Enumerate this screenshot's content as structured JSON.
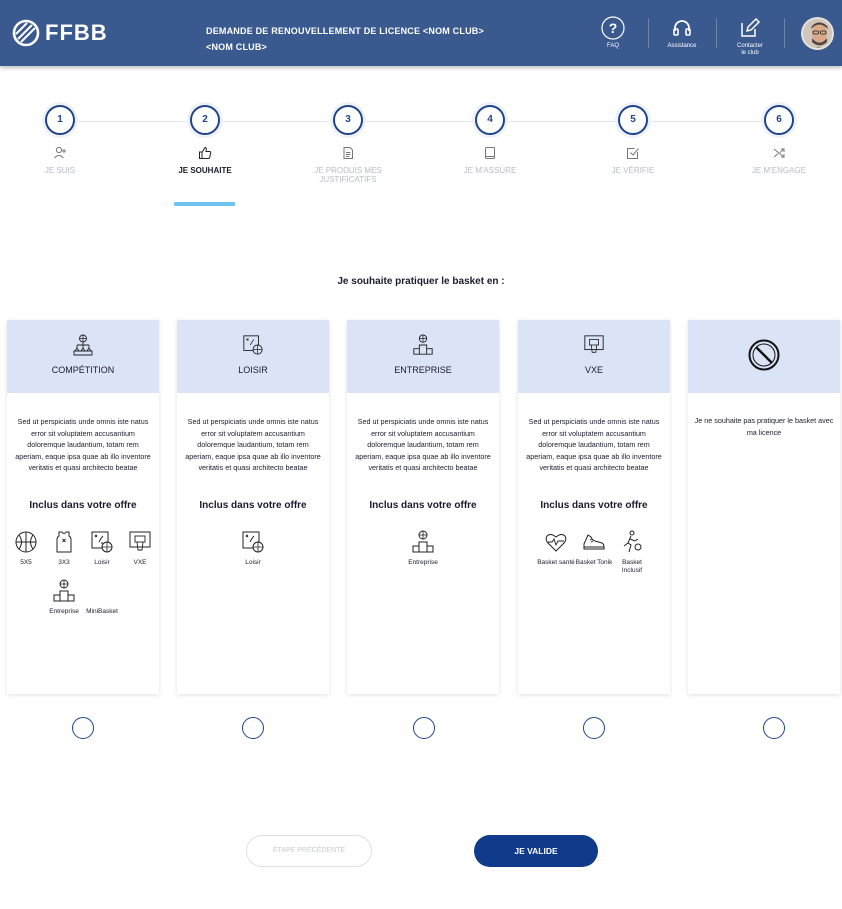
{
  "header": {
    "logo_text": "FFBB",
    "title_line1": "DEMANDE DE RENOUVELLEMENT DE LICENCE <NOM CLUB>",
    "title_line2": "<NOM CLUB>",
    "faq_label": "FAQ",
    "assistance_label": "Assistance",
    "contact_line1": "Contacter",
    "contact_line2": "le club"
  },
  "steps": [
    {
      "number": "1",
      "label": "JE SUIS",
      "icon": "user-add-icon"
    },
    {
      "number": "2",
      "label": "JE SOUHAITE",
      "icon": "thumbs-up-icon"
    },
    {
      "number": "3",
      "label": "JE PRODUIS MES JUSTIFICATIFS",
      "icon": "document-icon"
    },
    {
      "number": "4",
      "label": "JE M'ASSURE",
      "icon": "book-icon"
    },
    {
      "number": "5",
      "label": "JE VÉRIFIE",
      "icon": "check-square-icon"
    },
    {
      "number": "6",
      "label": "JE M'ENGAGE",
      "icon": "shuffle-icon"
    }
  ],
  "question": "Je souhaite pratiquer le basket en :",
  "cards": [
    {
      "title": "COMPÉTITION",
      "description": "Sed ut perspiciatis unde omnis iste natus error sit voluptatem accusantium doloremque laudantium, totam rem aperiam, eaque ipsa quae ab illo inventore veritatis et quasi architecto beatae",
      "included_title": "Inclus dans votre offre",
      "included": [
        "5X5",
        "3X3",
        "Loisir",
        "VXE",
        "Entreprise",
        "MiniBasket"
      ]
    },
    {
      "title": "LOISIR",
      "description": "Sed ut perspiciatis unde omnis iste natus error sit voluptatem accusantium doloremque laudantium, totam rem aperiam, eaque ipsa quae ab illo inventore veritatis et quasi architecto beatae",
      "included_title": "Inclus dans votre offre",
      "included": [
        "Loisir"
      ]
    },
    {
      "title": "ENTREPRISE",
      "description": "Sed ut perspiciatis unde omnis iste natus error sit voluptatem accusantium doloremque laudantium, totam rem aperiam, eaque ipsa quae ab illo inventore veritatis et quasi architecto beatae",
      "included_title": "Inclus dans votre offre",
      "included": [
        "Entreprise"
      ]
    },
    {
      "title": "VXE",
      "description": "Sed ut perspiciatis unde omnis iste natus error sit voluptatem accusantium doloremque laudantium, totam rem aperiam, eaque ipsa quae ab illo inventore veritatis et quasi architecto beatae",
      "included_title": "Inclus dans votre offre",
      "included": [
        "Basket santé",
        "Basket Tonik",
        "Basket Inclusif"
      ]
    },
    {
      "title": "",
      "description": "Je ne souhaite pas pratiquer le basket avec ma licence"
    }
  ],
  "buttons": {
    "previous": "ÉTAPE PRÉCÉDENTE",
    "validate": "JE VALIDE"
  },
  "colors": {
    "header_bg": "#3a598f",
    "primary": "#0f3b8a",
    "card_header": "#dbe3f7",
    "active_underline": "#6fc4ef"
  }
}
